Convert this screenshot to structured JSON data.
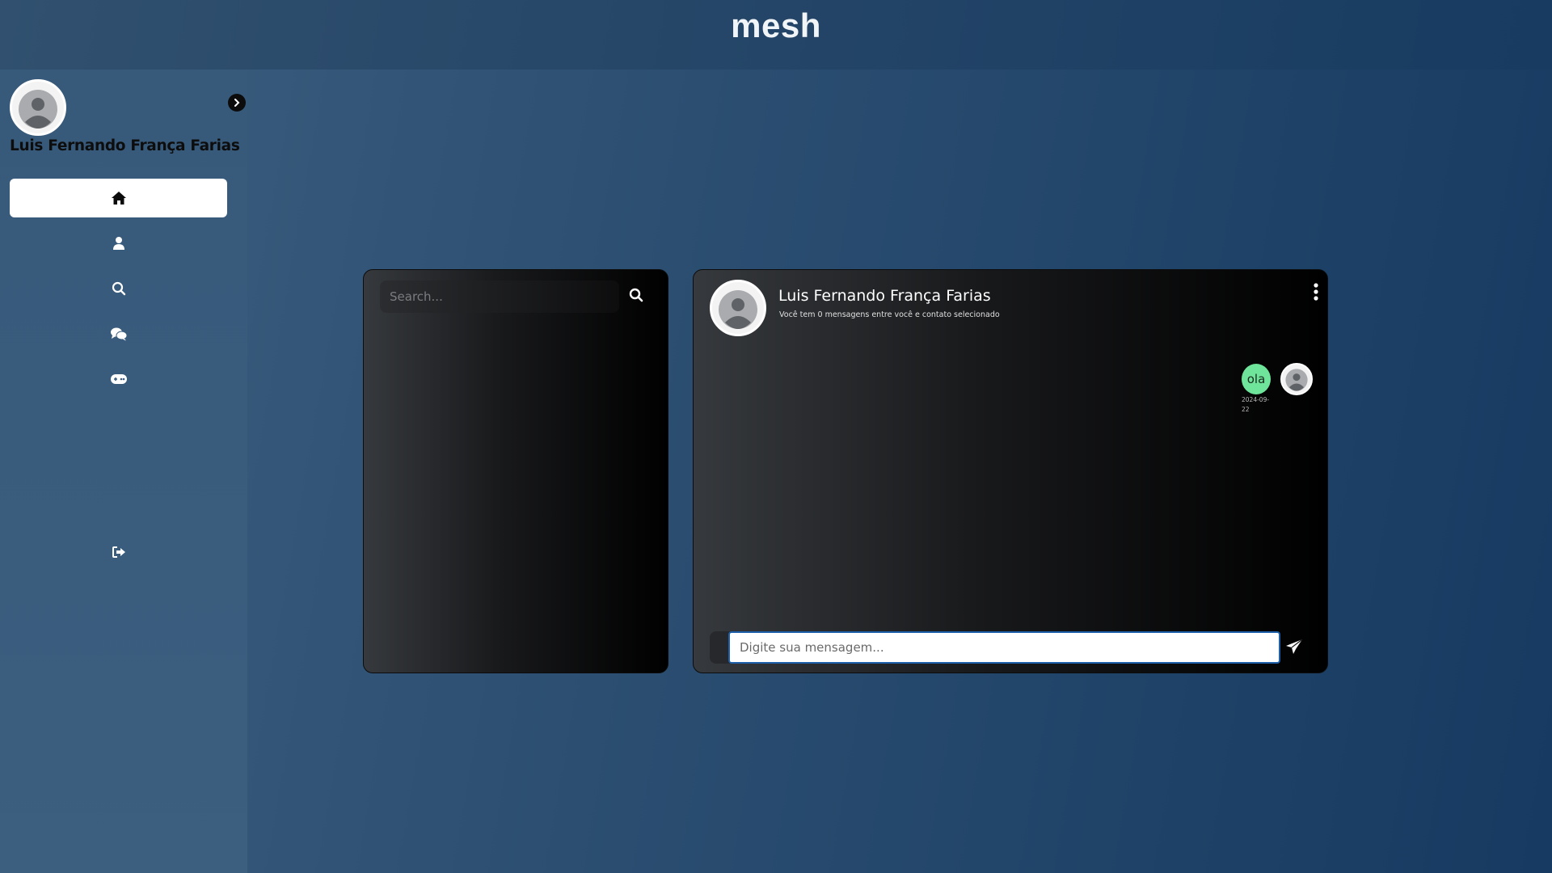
{
  "app": {
    "brand": "mesh"
  },
  "sidebar": {
    "user_name": "Luis Fernando França Farias",
    "avatar_icon": "user-avatar-icon",
    "toggle_icon": "chevron-right-icon",
    "items": [
      {
        "icon": "home-icon",
        "active": true
      },
      {
        "icon": "user-icon",
        "active": false
      },
      {
        "icon": "search-icon",
        "active": false
      },
      {
        "icon": "chat-icon",
        "active": false
      },
      {
        "icon": "gamepad-icon",
        "active": false
      }
    ],
    "logout_icon": "logout-icon"
  },
  "contacts": {
    "search_placeholder": "Search...",
    "search_icon": "search-icon"
  },
  "chat": {
    "contact_name": "Luis Fernando França Farias",
    "subtitle": "Você tem 0 mensagens entre você e contato selecionado",
    "menu_icon": "kebab-menu-icon",
    "messages": [
      {
        "text": "ola",
        "date": "2024-09-22",
        "color": "#6ee59a"
      }
    ],
    "input_placeholder": "Digite sua mensagem...",
    "send_icon": "send-icon"
  },
  "colors": {
    "accent": "#1d5fa8",
    "bubble": "#6ee59a"
  }
}
